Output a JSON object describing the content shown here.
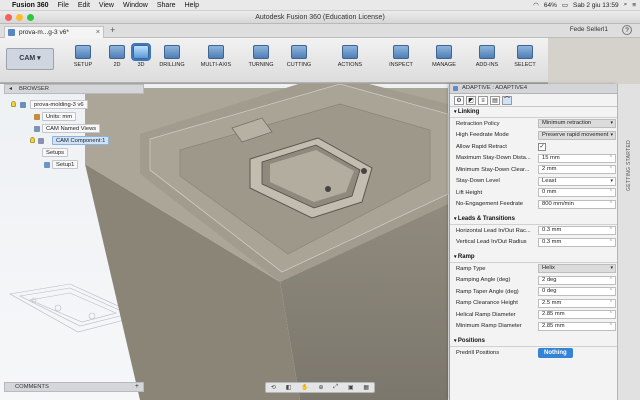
{
  "menubar": {
    "app_name": "Fusion 360",
    "items": [
      "File",
      "Edit",
      "View",
      "Window",
      "Share",
      "Help"
    ],
    "battery": "64%",
    "datetime": "Sab 2 giu  13:59"
  },
  "window": {
    "title": "Autodesk Fusion 360 (Education License)"
  },
  "tab": {
    "label": "prova-m...g-3 v6*",
    "user": "Fede Sellerl1"
  },
  "toolbar": {
    "workspace": "CAM",
    "groups": [
      "SETUP",
      "2D",
      "3D",
      "DRILLING",
      "MULTI-AXIS",
      "TURNING",
      "CUTTING",
      "ACTIONS",
      "INSPECT",
      "MANAGE",
      "ADD-INS",
      "SELECT"
    ]
  },
  "browser": {
    "header": "BROWSER",
    "root": "prova-molding-3 v6",
    "units": "Units: mm",
    "named_views": "CAM Named Views",
    "component": "CAM Component:1",
    "setups": "Setups",
    "setup": "Setup1"
  },
  "comments": {
    "label": "COMMENTS"
  },
  "panel": {
    "title": "ADAPTIVE : ADAPTIVE4",
    "sections": {
      "linking": "Linking",
      "leads": "Leads & Transitions",
      "ramp": "Ramp",
      "positions": "Positions"
    },
    "linking": [
      {
        "label": "Retraction Policy",
        "value": "Minimum retraction"
      },
      {
        "label": "High Feedrate Mode",
        "value": "Preserve rapid movement"
      },
      {
        "label": "Allow Rapid Retract",
        "value": "✓"
      },
      {
        "label": "Maximum Stay-Down Dista...",
        "value": "15 mm"
      },
      {
        "label": "Minimum Stay-Down Clear...",
        "value": "2 mm"
      },
      {
        "label": "Stay-Down Level",
        "value": "Least"
      },
      {
        "label": "Lift Height",
        "value": "0 mm"
      },
      {
        "label": "No-Engagement Feedrate",
        "value": "800 mm/min"
      }
    ],
    "leads": [
      {
        "label": "Horizontal Lead In/Out Rac...",
        "value": "0.3 mm"
      },
      {
        "label": "Vertical Lead In/Out Radius",
        "value": "0.3 mm"
      }
    ],
    "ramp": [
      {
        "label": "Ramp Type",
        "value": "Helix"
      },
      {
        "label": "Ramping Angle (deg)",
        "value": "2 deg"
      },
      {
        "label": "Ramp Taper Angle (deg)",
        "value": "0 deg"
      },
      {
        "label": "Ramp Clearance Height",
        "value": "2.5 mm"
      },
      {
        "label": "Helical Ramp Diameter",
        "value": "2.85 mm"
      },
      {
        "label": "Minimum Ramp Diameter",
        "value": "2.85 mm"
      }
    ],
    "positions": [
      {
        "label": "Predrill Positions",
        "value": "Nothing"
      }
    ]
  },
  "right_sidebar": {
    "label": "GETTING STARTED"
  }
}
